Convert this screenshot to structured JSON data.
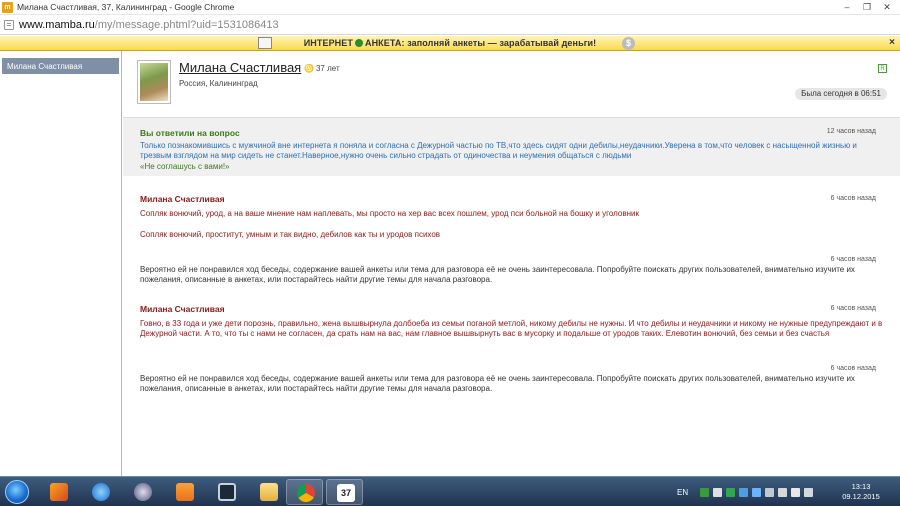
{
  "window": {
    "title": "Милана Счастливая, 37, Калининград - Google Chrome",
    "app_icon": "mamba-icon",
    "controls": [
      "minimize",
      "maximize",
      "close"
    ]
  },
  "address_bar": {
    "host": "www.mamba.ru",
    "path": "/my/message.phtml?uid=1531086413"
  },
  "banner": {
    "text_before": "ИНТЕРНЕТ",
    "text_after": "АНКЕТА: заполняй анкеты — зарабатывай деньги!",
    "dollar_symbol": "$",
    "close": "×"
  },
  "sidebar": {
    "items": [
      {
        "label": "Милана Счастливая"
      }
    ]
  },
  "profile": {
    "name": "Милана Счастливая",
    "age": "37 лет",
    "location": "Россия, Калининград",
    "badge": "R",
    "last_seen": "Была сегодня в 06:51"
  },
  "answered": {
    "label": "Вы ответили на вопрос",
    "time": "12 часов назад",
    "question": "Только познакомившись с мужчиной вне интернета я поняла и согласна с Дежурной частью по ТВ,что здесь сидят одни дебилы,неудачники.Уверена в том,что человек с насыщенной жизнью и трезвым взглядом на мир сидеть не станет.Наверное,нужно очень сильно страдать от одиночества и неумения общаться с людьми",
    "reply": "«Не соглашусь с вами!»"
  },
  "messages": [
    {
      "author": "Милана Счастливая",
      "time": "6 часов назад",
      "line1": "Сопляк вонючий, урод, а на ваше мнение нам наплевать, мы просто на хер вас всех пошлем, урод пси больной на бошку и уголовник",
      "line2": "Сопляк вонючий, проститут, умным и так видно, дебилов как ты и уродов психов"
    },
    {
      "time": "6 часов назад",
      "text": "Вероятно ей не понравился ход беседы, содержание вашей анкеты или тема для разговора её не очень заинтересовала. Попробуйте поискать других пользователей, внимательно изучите их пожелания, описанные в анкетах, или постарайтесь найти другие темы для начала разговора."
    },
    {
      "author": "Милана Счастливая",
      "time": "6 часов назад",
      "text": "Говно, в 33 года и уже дети порознь, правильно, жена вышвырнула долбоеба из семьи поганой метлой, никому дебилы не нужны. И что дебилы и неудачники и никому не нужные предупреждают и в Дежурной части. А то, что ты с нами не согласен, да срать нам на вас, нам главное вышвырнуть вас в мусорку и подальше от уродов таких. Елевотин вонючий, без семьи и без счастья"
    },
    {
      "time": "6 часов назад",
      "text": "Вероятно ей не понравился ход беседы, содержание вашей анкеты или тема для разговора её не очень заинтересовала. Попробуйте поискать других пользователей, внимательно изучите их пожелания, описанные в анкетах, или постарайтесь найти другие темы для начала разговора."
    }
  ],
  "taskbar": {
    "apps": [
      "firefox-icon",
      "ie-icon",
      "media-icon",
      "player-icon",
      "terminal-icon",
      "explorer-icon",
      "chrome-icon",
      "calendar-icon"
    ],
    "calendar_day": "37",
    "language": "EN",
    "time": "13:13",
    "date": "09.12.2015",
    "colors": {
      "taskbar": "#2a4263",
      "accent": "#1c6fd0"
    }
  }
}
